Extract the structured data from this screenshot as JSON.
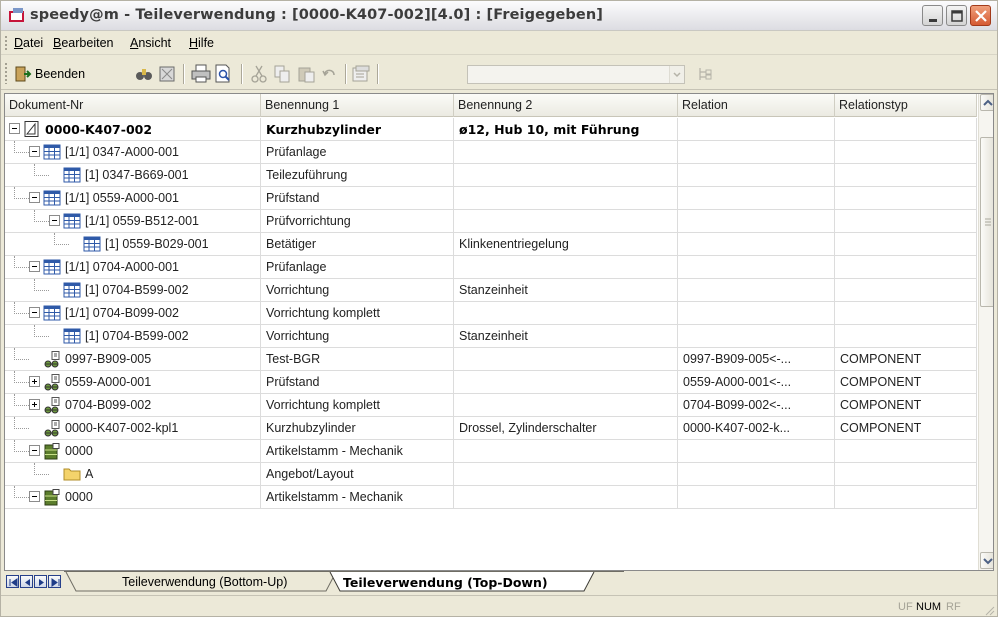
{
  "window": {
    "title": "speedy@m - Teileverwendung : [0000-K407-002][4.0] : [Freigegeben]"
  },
  "menu": {
    "items": [
      {
        "label": "Datei",
        "underline": "D"
      },
      {
        "label": "Bearbeiten",
        "underline": "B"
      },
      {
        "label": "Ansicht",
        "underline": "A"
      },
      {
        "label": "Hilfe",
        "underline": "H"
      }
    ]
  },
  "toolbar": {
    "exit_label": "Beenden",
    "combo_value": ""
  },
  "grid": {
    "columns": [
      "Dokument-Nr",
      "Benennung 1",
      "Benennung 2",
      "Relation",
      "Relationstyp"
    ],
    "rows": [
      {
        "doc": "0000-K407-002",
        "b1": "Kurzhubzylinder",
        "b2": "ø12, Hub  10, mit Führung",
        "rel": "",
        "reltype": "",
        "bold": true,
        "level": 0,
        "icon": "drawing-icon",
        "expander": "minus"
      },
      {
        "doc": "[1/1] 0347-A000-001",
        "b1": "Prüfanlage",
        "b2": "",
        "rel": "",
        "reltype": "",
        "level": 1,
        "icon": "table-icon",
        "expander": "minus"
      },
      {
        "doc": "[1] 0347-B669-001",
        "b1": "Teilezuführung",
        "b2": "",
        "rel": "",
        "reltype": "",
        "level": 2,
        "icon": "table-icon",
        "expander": ""
      },
      {
        "doc": "[1/1] 0559-A000-001",
        "b1": "Prüfstand",
        "b2": "",
        "rel": "",
        "reltype": "",
        "level": 1,
        "icon": "table-icon",
        "expander": "minus"
      },
      {
        "doc": "[1/1] 0559-B512-001",
        "b1": "Prüfvorrichtung",
        "b2": "",
        "rel": "",
        "reltype": "",
        "level": 2,
        "icon": "table-icon",
        "expander": "minus"
      },
      {
        "doc": "[1] 0559-B029-001",
        "b1": "Betätiger",
        "b2": "Klinkenentriegelung",
        "rel": "",
        "reltype": "",
        "level": 3,
        "icon": "table-icon",
        "expander": ""
      },
      {
        "doc": "[1/1] 0704-A000-001",
        "b1": "Prüfanlage",
        "b2": "",
        "rel": "",
        "reltype": "",
        "level": 1,
        "icon": "table-icon",
        "expander": "minus"
      },
      {
        "doc": "[1] 0704-B599-002",
        "b1": "Vorrichtung",
        "b2": "Stanzeinheit",
        "rel": "",
        "reltype": "",
        "level": 2,
        "icon": "table-icon",
        "expander": ""
      },
      {
        "doc": "[1/1] 0704-B099-002",
        "b1": "Vorrichtung komplett",
        "b2": "",
        "rel": "",
        "reltype": "",
        "level": 1,
        "icon": "table-icon",
        "expander": "minus"
      },
      {
        "doc": "[1] 0704-B599-002",
        "b1": "Vorrichtung",
        "b2": "Stanzeinheit",
        "rel": "",
        "reltype": "",
        "level": 2,
        "icon": "table-icon",
        "expander": ""
      },
      {
        "doc": "0997-B909-005",
        "b1": "Test-BGR",
        "b2": "",
        "rel": "0997-B909-005<-...",
        "reltype": "COMPONENT",
        "level": 1,
        "icon": "component-icon",
        "expander": ""
      },
      {
        "doc": "0559-A000-001",
        "b1": "Prüfstand",
        "b2": "",
        "rel": "0559-A000-001<-...",
        "reltype": "COMPONENT",
        "level": 1,
        "icon": "component-icon",
        "expander": "plus"
      },
      {
        "doc": "0704-B099-002",
        "b1": "Vorrichtung komplett",
        "b2": "",
        "rel": "0704-B099-002<-...",
        "reltype": "COMPONENT",
        "level": 1,
        "icon": "component-icon",
        "expander": "plus"
      },
      {
        "doc": "0000-K407-002-kpl1",
        "b1": "Kurzhubzylinder",
        "b2": "Drossel, Zylinderschalter",
        "rel": "0000-K407-002-k...",
        "reltype": "COMPONENT",
        "level": 1,
        "icon": "component-icon",
        "expander": ""
      },
      {
        "doc": "0000",
        "b1": "Artikelstamm - Mechanik",
        "b2": "",
        "rel": "",
        "reltype": "",
        "level": 1,
        "icon": "cabinet-icon",
        "expander": "minus"
      },
      {
        "doc": "A",
        "b1": "Angebot/Layout",
        "b2": "",
        "rel": "",
        "reltype": "",
        "level": 2,
        "icon": "folder-icon",
        "expander": ""
      },
      {
        "doc": "0000",
        "b1": "Artikelstamm - Mechanik",
        "b2": "",
        "rel": "",
        "reltype": "",
        "level": 1,
        "icon": "cabinet-icon",
        "expander": "minus"
      }
    ]
  },
  "tabs": [
    {
      "label": "Teileverwendung (Bottom-Up)",
      "active": false
    },
    {
      "label": "Teileverwendung (Top-Down)",
      "active": true
    }
  ],
  "status": {
    "indicators": [
      "UF",
      "NUM",
      "RF"
    ]
  },
  "colors": {
    "highlight_active": "#000000",
    "disabled": "#a5a397",
    "table_icon_blue": "#2f5aa8"
  }
}
